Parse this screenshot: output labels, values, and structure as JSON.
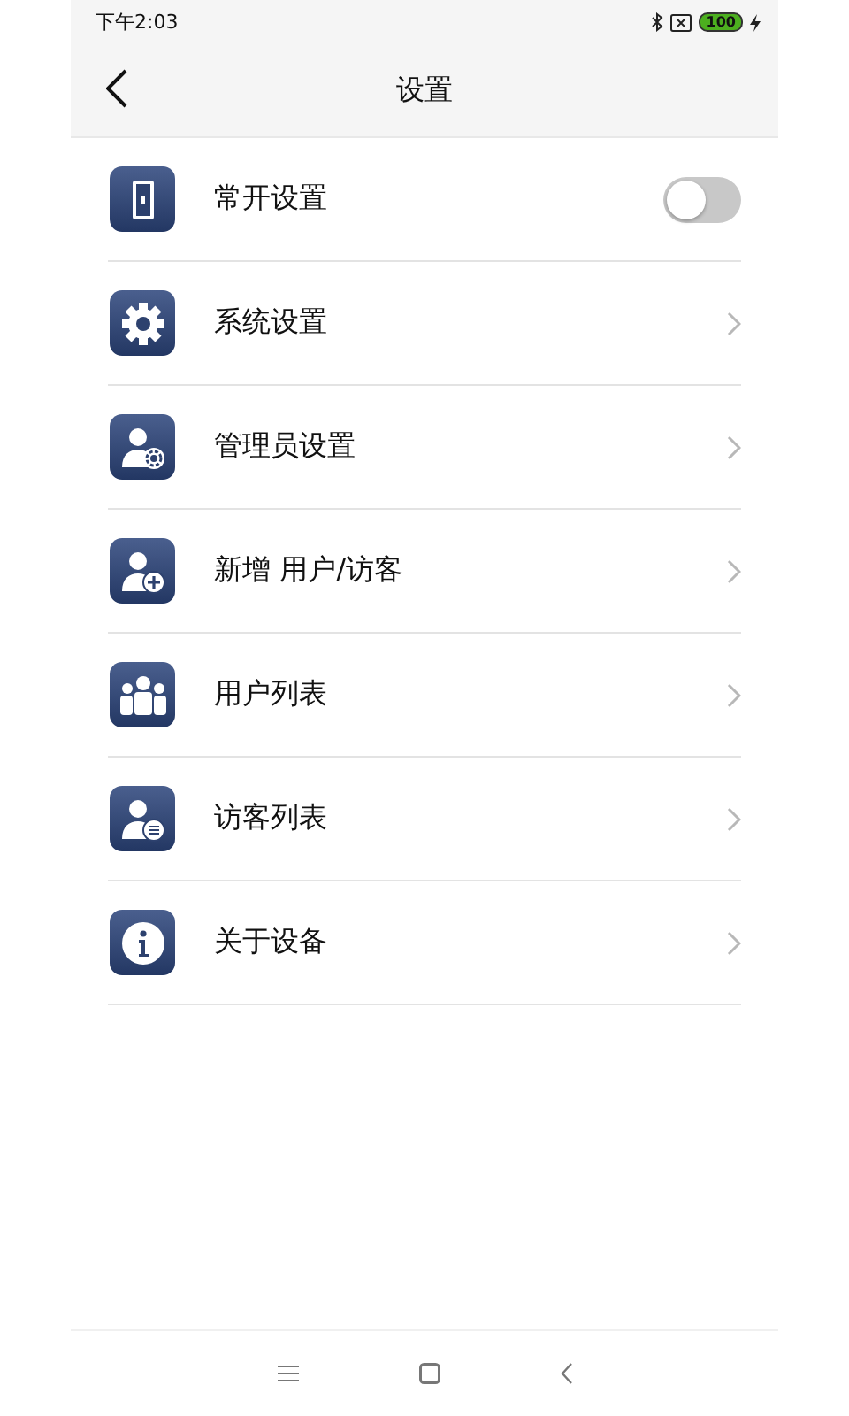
{
  "status_bar": {
    "time": "下午2:03",
    "battery": "100"
  },
  "header": {
    "title": "设置"
  },
  "items": [
    {
      "kind": "toggle",
      "label": "常开设置",
      "on": false
    },
    {
      "kind": "link",
      "label": "系统设置"
    },
    {
      "kind": "link",
      "label": "管理员设置"
    },
    {
      "kind": "link",
      "label": "新增 用户/访客"
    },
    {
      "kind": "link",
      "label": "用户列表"
    },
    {
      "kind": "link",
      "label": "访客列表"
    },
    {
      "kind": "link",
      "label": "关于设备"
    }
  ]
}
